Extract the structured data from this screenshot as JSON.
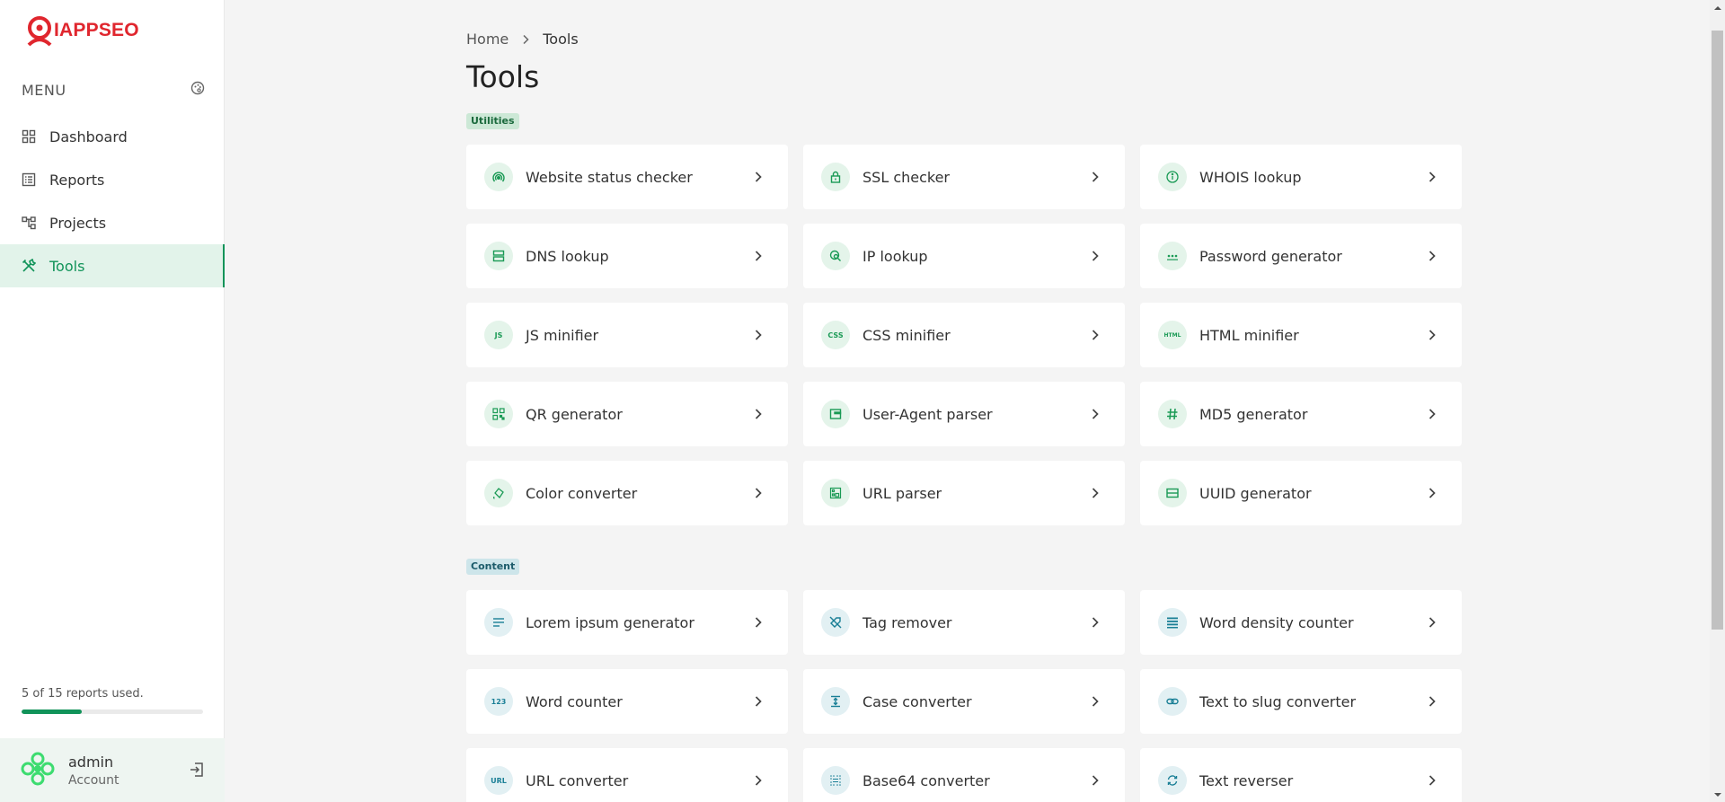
{
  "brand": {
    "name": "IAPPSEO",
    "color": "#e0262e"
  },
  "sidebar": {
    "menu_title": "MENU",
    "items": [
      {
        "label": "Dashboard",
        "icon": "grid-icon"
      },
      {
        "label": "Reports",
        "icon": "list-icon"
      },
      {
        "label": "Projects",
        "icon": "hierarchy-icon"
      },
      {
        "label": "Tools",
        "icon": "tools-icon",
        "active": true
      }
    ],
    "usage_text": "5 of 15 reports used.",
    "usage_fraction": 0.333,
    "account": {
      "name": "admin",
      "sub": "Account"
    }
  },
  "breadcrumb": {
    "home": "Home",
    "current": "Tools"
  },
  "page_title": "Tools",
  "sections": [
    {
      "badge": "Utilities",
      "tools": [
        {
          "label": "Website status checker",
          "icon": "broadcast-icon"
        },
        {
          "label": "SSL checker",
          "icon": "lock-icon"
        },
        {
          "label": "WHOIS lookup",
          "icon": "info-icon"
        },
        {
          "label": "DNS lookup",
          "icon": "server-icon"
        },
        {
          "label": "IP lookup",
          "icon": "location-search-icon"
        },
        {
          "label": "Password generator",
          "icon": "password-dots-icon"
        },
        {
          "label": "JS minifier",
          "icon": "js-icon",
          "icon_text": "JS"
        },
        {
          "label": "CSS minifier",
          "icon": "css-icon",
          "icon_text": "CSS"
        },
        {
          "label": "HTML minifier",
          "icon": "html-icon",
          "icon_text": "HTML"
        },
        {
          "label": "QR generator",
          "icon": "qr-code-icon"
        },
        {
          "label": "User-Agent parser",
          "icon": "browser-window-icon"
        },
        {
          "label": "MD5 generator",
          "icon": "hash-icon"
        },
        {
          "label": "Color converter",
          "icon": "paint-bucket-icon"
        },
        {
          "label": "URL parser",
          "icon": "url-grid-icon"
        },
        {
          "label": "UUID generator",
          "icon": "card-icon"
        }
      ]
    },
    {
      "badge": "Content",
      "tools": [
        {
          "label": "Lorem ipsum generator",
          "icon": "text-lines-icon"
        },
        {
          "label": "Tag remover",
          "icon": "tag-off-icon"
        },
        {
          "label": "Word density counter",
          "icon": "density-icon"
        },
        {
          "label": "Word counter",
          "icon": "numbers-icon",
          "icon_text": "123"
        },
        {
          "label": "Case converter",
          "icon": "vertical-align-icon"
        },
        {
          "label": "Text to slug converter",
          "icon": "link-icon"
        },
        {
          "label": "URL converter",
          "icon": "url-icon",
          "icon_text": "URL"
        },
        {
          "label": "Base64 converter",
          "icon": "dotted-grid-icon"
        },
        {
          "label": "Text reverser",
          "icon": "refresh-icon"
        }
      ]
    }
  ],
  "colors": {
    "accent": "#119359",
    "utilities_badge_bg": "#cce8d6",
    "content_badge_bg": "#cde5ea"
  }
}
